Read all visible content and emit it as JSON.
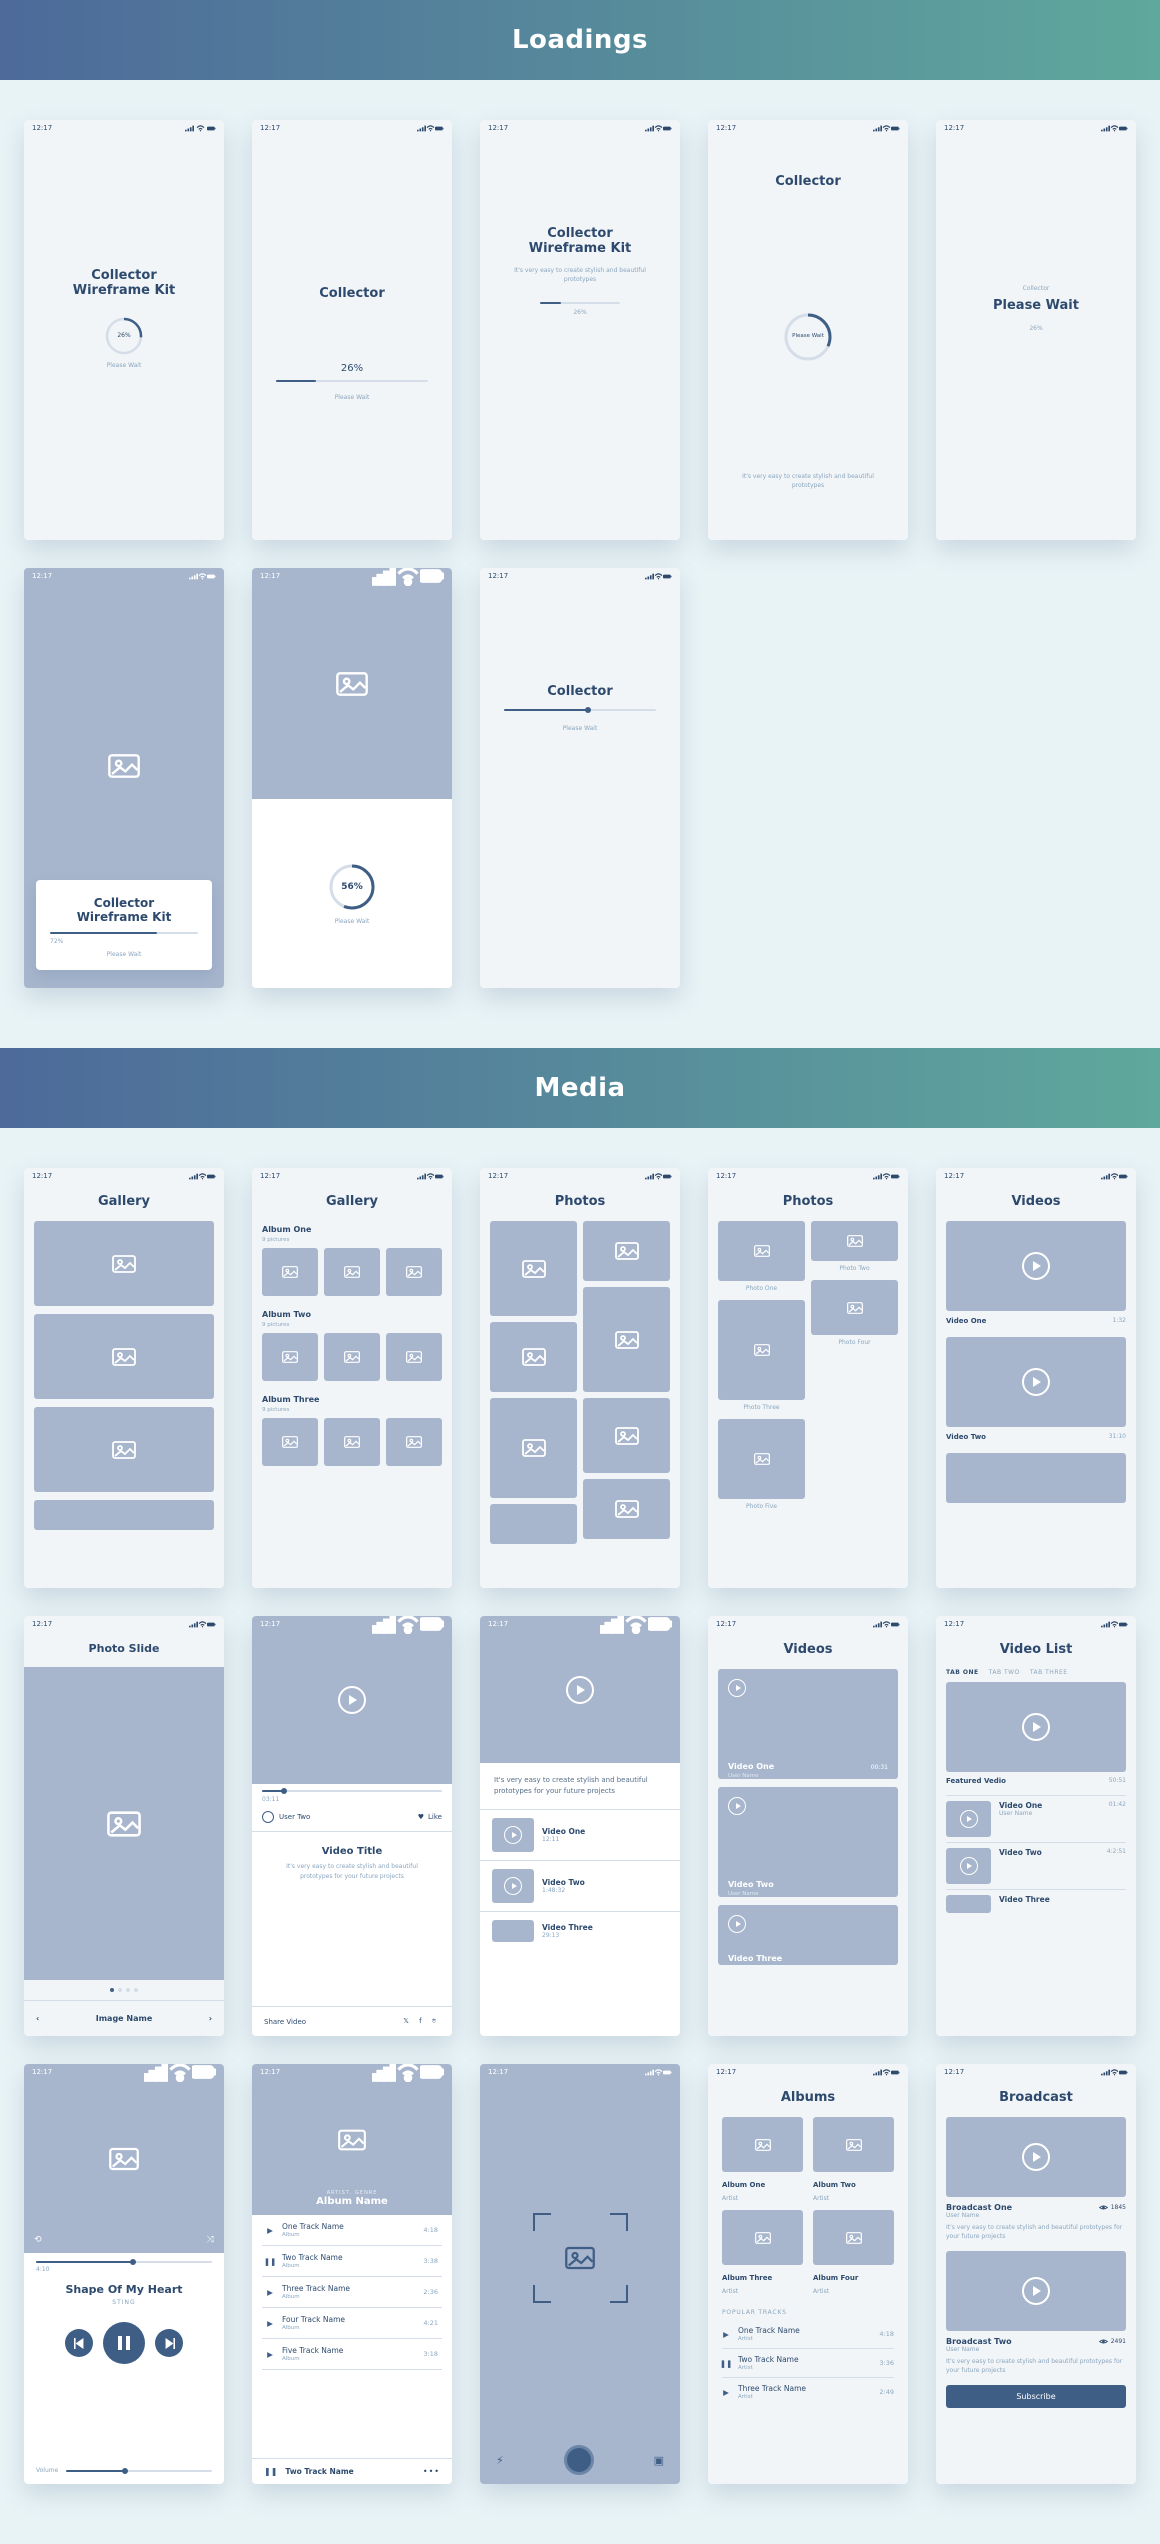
{
  "sections": {
    "loadings": "Loadings",
    "media": "Media"
  },
  "status": {
    "time": "12:17"
  },
  "loading": {
    "s1": {
      "title1": "Collector",
      "title2": "Wireframe Kit",
      "pct": "26%",
      "wait": "Please Wait"
    },
    "s2": {
      "title": "Collector",
      "pct": "26%",
      "wait": "Please Wait"
    },
    "s3": {
      "title1": "Collector",
      "title2": "Wireframe Kit",
      "desc": "It's very easy to create stylish and beautiful prototypes",
      "pct": "26%"
    },
    "s4": {
      "title": "Collector",
      "ring": "Please Wait",
      "foot": "It's very easy to create stylish and beautiful prototypes"
    },
    "s5": {
      "brand": "Collector",
      "wait": "Please Wait",
      "pct": "26%"
    },
    "s6": {
      "title1": "Collector",
      "title2": "Wireframe Kit",
      "pct": "72%",
      "wait": "Please Wait"
    },
    "s7": {
      "pct": "56%",
      "wait": "Please Wait"
    },
    "s8": {
      "title": "Collector",
      "wait": "Please Wait"
    }
  },
  "media": {
    "gallery": {
      "title": "Gallery"
    },
    "gallery2": {
      "title": "Gallery",
      "a1": "Album One",
      "a2": "Album Two",
      "a3": "Album Three",
      "sub": "9 pictures"
    },
    "photos1": {
      "title": "Photos"
    },
    "photos2": {
      "title": "Photos",
      "p1": "Photo One",
      "p2": "Photo Two",
      "p3": "Photo Three",
      "p4": "Photo Four",
      "p5": "Photo Five"
    },
    "videos1": {
      "title": "Videos",
      "v1": "Video One",
      "v1t": "1:32",
      "v2": "Video Two",
      "v2t": "31:10"
    },
    "photoslide": {
      "title": "Photo Slide",
      "name": "Image Name"
    },
    "vplayer": {
      "time": "03:11",
      "user": "User Two",
      "like": "Like",
      "vt": "Video Title",
      "desc": "It's very easy to create stylish and beautiful prototypes for your future projects",
      "share": "Share Video"
    },
    "vlist1": {
      "desc": "It's very easy to create stylish and beautiful prototypes for your future projects",
      "v1": "Video One",
      "v1t": "12:11",
      "v2": "Video Two",
      "v2t": "1:48:32",
      "v3": "Video Three",
      "v3t": "29:13"
    },
    "videos2": {
      "title": "Videos",
      "v1": "Video One",
      "v1u": "User Name",
      "v1t": "00:31",
      "v2": "Video Two",
      "v2u": "User Name",
      "v3": "Video Three"
    },
    "videolist": {
      "title": "Video List",
      "t1": "TAB ONE",
      "t2": "TAB TWO",
      "t3": "TAB THREE",
      "fv": "Featured Vedio",
      "fvt": "50:51",
      "v1": "Video One",
      "v1u": "User Name",
      "v1t": "01:42",
      "v2": "Video Two",
      "v2t": "4:2:51",
      "v3": "Video Three"
    },
    "player1": {
      "cur": "4:10",
      "song": "Shape Of My Heart",
      "artist": "STING",
      "vol": "Volume"
    },
    "player2": {
      "meta": "ARTIST, GENRE",
      "album": "Album Name",
      "t1": "One Track Name",
      "t1d": "4:18",
      "t1s": "Album",
      "t2": "Two Track Name",
      "t2d": "3:38",
      "t2s": "Album",
      "t3": "Three Track Name",
      "t3d": "2:36",
      "t3s": "Album",
      "t4": "Four Track Name",
      "t4d": "4:21",
      "t4s": "Album",
      "t5": "Five Track Name",
      "t5d": "3:18",
      "t5s": "Album",
      "np": "Two Track Name"
    },
    "albums": {
      "title": "Albums",
      "a1": "Album One",
      "a2": "Album Two",
      "a3": "Album Three",
      "a4": "Album Four",
      "as": "Artist",
      "pop": "POPULAR TRACKS",
      "t1": "One Track Name",
      "t1d": "4:18",
      "t2": "Two Track Name",
      "t2d": "3:36",
      "t2s": "Artist",
      "t3": "Three Track Name",
      "t3d": "2:49",
      "t3s": "Artist"
    },
    "broadcast": {
      "title": "Broadcast",
      "b1": "Broadcast One",
      "b1v": "1845",
      "b1u": "User Name",
      "desc": "It's very easy to create stylish and beautiful prototypes for your future projects",
      "b2": "Broadcast Two",
      "b2v": "2491",
      "b2u": "User Name",
      "btn": "Subscribe"
    }
  }
}
